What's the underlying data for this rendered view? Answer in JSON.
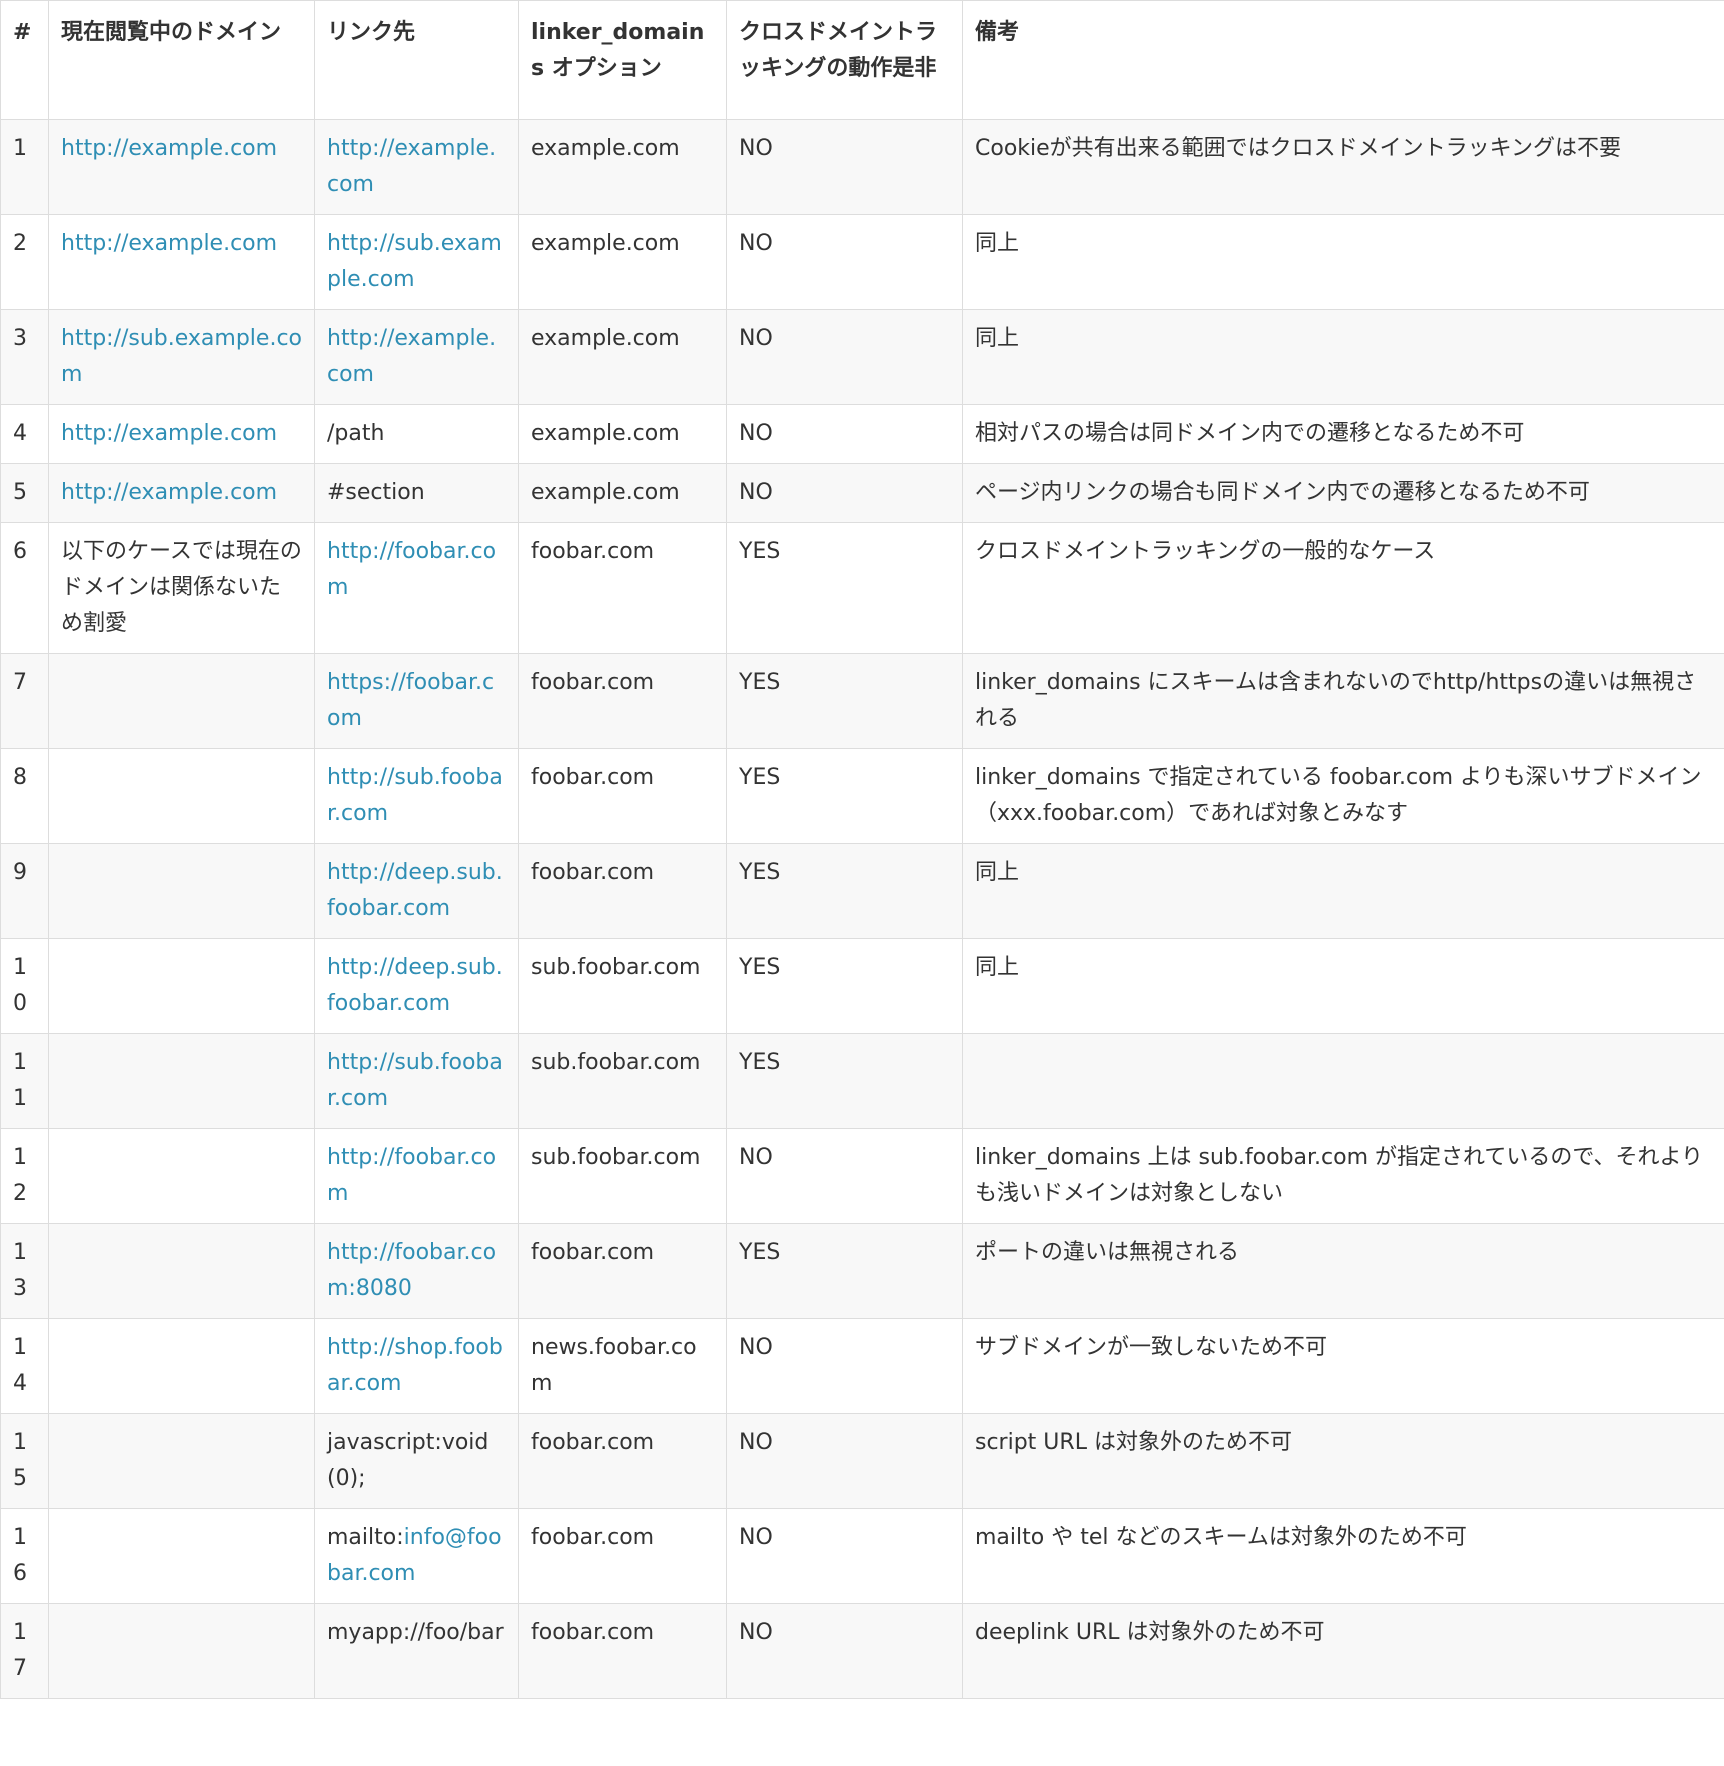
{
  "table": {
    "headers": [
      "#",
      "現在閲覧中のドメイン",
      "リンク先",
      "linker_domains オプション",
      "クロスドメイントラッキングの動作是非",
      "備考"
    ],
    "rows": [
      {
        "num": "1",
        "domain": "http://example.com",
        "domain_link": true,
        "link_prefix": "",
        "link": "http://example.com",
        "link_is_link": true,
        "linker": "example.com",
        "result": "NO",
        "note": "Cookieが共有出来る範囲ではクロスドメイントラッキングは不要"
      },
      {
        "num": "2",
        "domain": "http://example.com",
        "domain_link": true,
        "link_prefix": "",
        "link": "http://sub.example.com",
        "link_is_link": true,
        "linker": "example.com",
        "result": "NO",
        "note": "同上"
      },
      {
        "num": "3",
        "domain": "http://sub.example.com",
        "domain_link": true,
        "link_prefix": "",
        "link": "http://example.com",
        "link_is_link": true,
        "linker": "example.com",
        "result": "NO",
        "note": "同上"
      },
      {
        "num": "4",
        "domain": "http://example.com",
        "domain_link": true,
        "link_prefix": "",
        "link": "/path",
        "link_is_link": false,
        "linker": "example.com",
        "result": "NO",
        "note": "相対パスの場合は同ドメイン内での遷移となるため不可"
      },
      {
        "num": "5",
        "domain": "http://example.com",
        "domain_link": true,
        "link_prefix": "",
        "link": "#section",
        "link_is_link": false,
        "linker": "example.com",
        "result": "NO",
        "note": "ページ内リンクの場合も同ドメイン内での遷移となるため不可"
      },
      {
        "num": "6",
        "domain": "以下のケースでは現在のドメインは関係ないため割愛",
        "domain_link": false,
        "link_prefix": "",
        "link": "http://foobar.com",
        "link_is_link": true,
        "linker": "foobar.com",
        "result": "YES",
        "note": "クロスドメイントラッキングの一般的なケース"
      },
      {
        "num": "7",
        "domain": "",
        "domain_link": false,
        "link_prefix": "",
        "link": "https://foobar.com",
        "link_is_link": true,
        "linker": "foobar.com",
        "result": "YES",
        "note": "linker_domains にスキームは含まれないのでhttp/httpsの違いは無視される"
      },
      {
        "num": "8",
        "domain": "",
        "domain_link": false,
        "link_prefix": "",
        "link": "http://sub.foobar.com",
        "link_is_link": true,
        "linker": "foobar.com",
        "result": "YES",
        "note": "linker_domains で指定されている foobar.com よりも深いサブドメイン（xxx.foobar.com）であれば対象とみなす"
      },
      {
        "num": "9",
        "domain": "",
        "domain_link": false,
        "link_prefix": "",
        "link": "http://deep.sub.foobar.com",
        "link_is_link": true,
        "linker": "foobar.com",
        "result": "YES",
        "note": "同上"
      },
      {
        "num": "10",
        "domain": "",
        "domain_link": false,
        "link_prefix": "",
        "link": "http://deep.sub.foobar.com",
        "link_is_link": true,
        "linker": "sub.foobar.com",
        "result": "YES",
        "note": "同上"
      },
      {
        "num": "11",
        "domain": "",
        "domain_link": false,
        "link_prefix": "",
        "link": "http://sub.foobar.com",
        "link_is_link": true,
        "linker": "sub.foobar.com",
        "result": "YES",
        "note": ""
      },
      {
        "num": "12",
        "domain": "",
        "domain_link": false,
        "link_prefix": "",
        "link": "http://foobar.com",
        "link_is_link": true,
        "linker": "sub.foobar.com",
        "result": "NO",
        "note": "linker_domains 上は sub.foobar.com が指定されているので、それよりも浅いドメインは対象としない"
      },
      {
        "num": "13",
        "domain": "",
        "domain_link": false,
        "link_prefix": "",
        "link": "http://foobar.com:8080",
        "link_is_link": true,
        "linker": "foobar.com",
        "result": "YES",
        "note": "ポートの違いは無視される"
      },
      {
        "num": "14",
        "domain": "",
        "domain_link": false,
        "link_prefix": "",
        "link": "http://shop.foobar.com",
        "link_is_link": true,
        "linker": "news.foobar.com",
        "result": "NO",
        "note": "サブドメインが一致しないため不可"
      },
      {
        "num": "15",
        "domain": "",
        "domain_link": false,
        "link_prefix": "",
        "link": "javascript:void(0);",
        "link_is_link": false,
        "linker": "foobar.com",
        "result": "NO",
        "note": "script URL は対象外のため不可"
      },
      {
        "num": "16",
        "domain": "",
        "domain_link": false,
        "link_prefix": "mailto:",
        "link": "info@foobar.com",
        "link_is_link": true,
        "linker": "foobar.com",
        "result": "NO",
        "note": "mailto や tel などのスキームは対象外のため不可"
      },
      {
        "num": "17",
        "domain": "",
        "domain_link": false,
        "link_prefix": "",
        "link": "myapp://foo/bar",
        "link_is_link": false,
        "linker": "foobar.com",
        "result": "NO",
        "note": "deeplink URL は対象外のため不可"
      }
    ]
  }
}
